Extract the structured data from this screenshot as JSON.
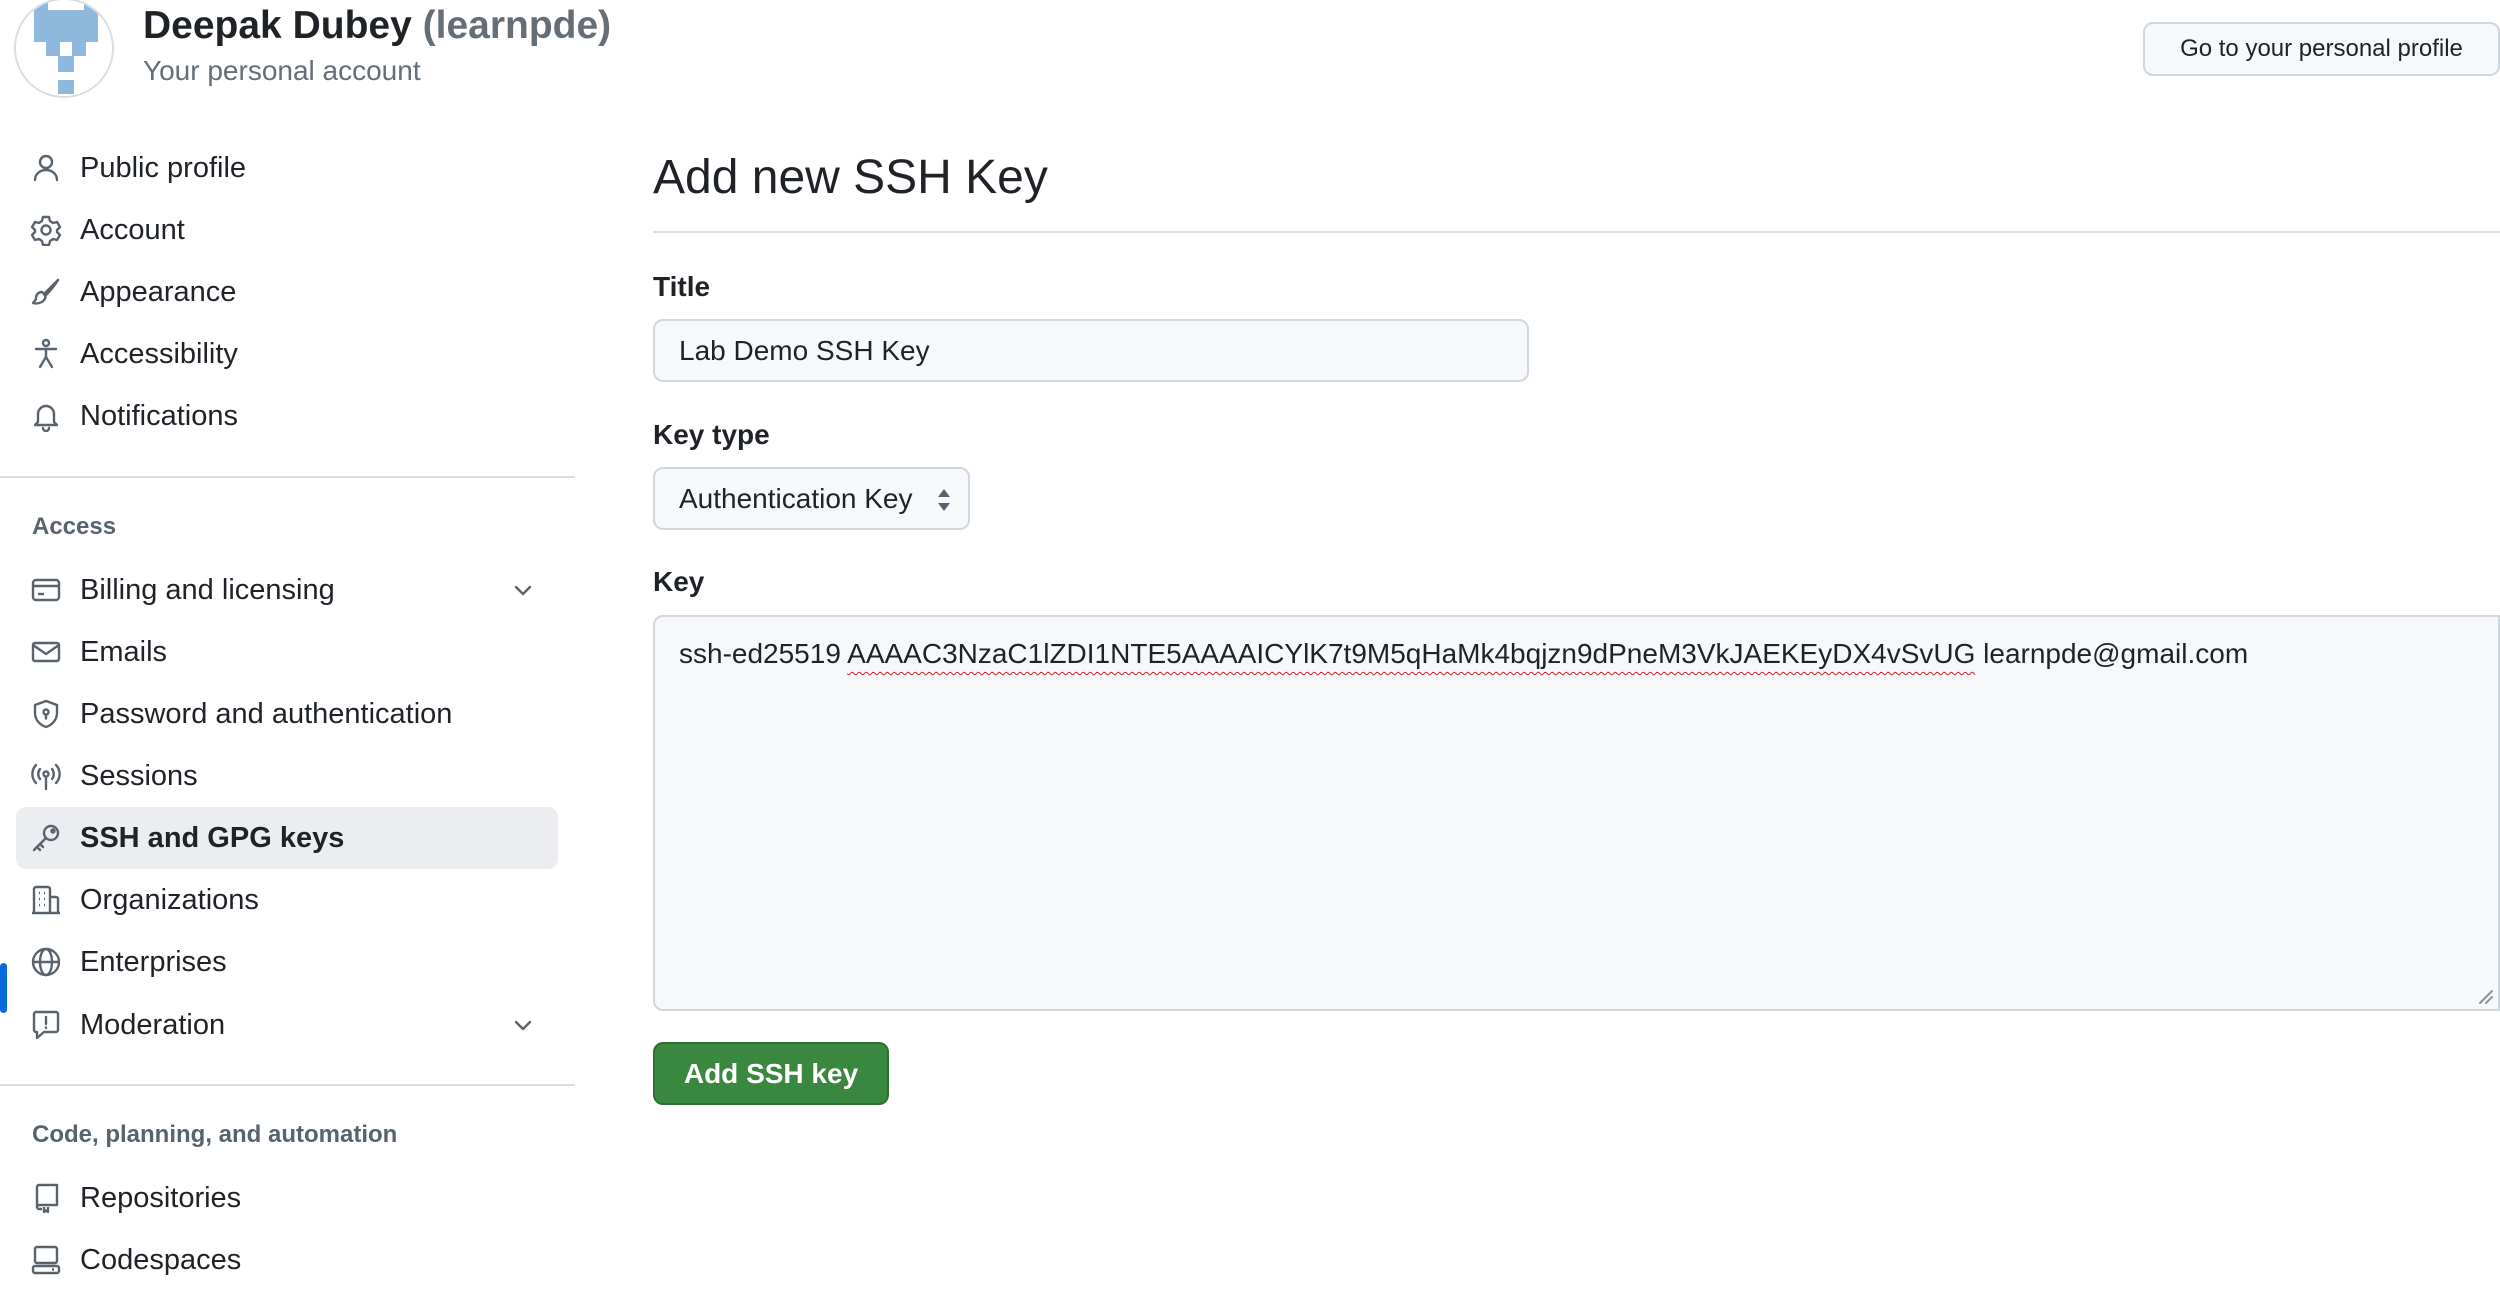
{
  "header": {
    "name": "Deepak Dubey",
    "login": "(learnpde)",
    "subtitle": "Your personal account",
    "profile_button": "Go to your personal profile"
  },
  "sidebar": {
    "items": [
      {
        "label": "Public profile",
        "icon": "person-icon"
      },
      {
        "label": "Account",
        "icon": "gear-icon"
      },
      {
        "label": "Appearance",
        "icon": "paintbrush-icon"
      },
      {
        "label": "Accessibility",
        "icon": "accessibility-icon"
      },
      {
        "label": "Notifications",
        "icon": "bell-icon"
      }
    ],
    "access_title": "Access",
    "access_items": [
      {
        "label": "Billing and licensing",
        "icon": "credit-card-icon",
        "expandable": true
      },
      {
        "label": "Emails",
        "icon": "mail-icon"
      },
      {
        "label": "Password and authentication",
        "icon": "shield-lock-icon"
      },
      {
        "label": "Sessions",
        "icon": "broadcast-icon"
      },
      {
        "label": "SSH and GPG keys",
        "icon": "key-icon",
        "active": true
      },
      {
        "label": "Organizations",
        "icon": "organization-icon"
      },
      {
        "label": "Enterprises",
        "icon": "globe-icon"
      },
      {
        "label": "Moderation",
        "icon": "report-icon",
        "expandable": true
      }
    ],
    "code_title": "Code, planning, and automation",
    "code_items": [
      {
        "label": "Repositories",
        "icon": "repo-icon"
      },
      {
        "label": "Codespaces",
        "icon": "codespaces-icon"
      }
    ]
  },
  "main": {
    "page_title": "Add new SSH Key",
    "title_label": "Title",
    "title_value": "Lab Demo SSH Key",
    "key_type_label": "Key type",
    "key_type_value": "Authentication Key",
    "key_label": "Key",
    "key_prefix": "ssh-ed25519 ",
    "key_body": "AAAAC3NzaC1lZDI1NTE5AAAAICYlK7t9M5qHaMk4bqjzn9dPneM3VkJAEKEyDX4vSvUG",
    "key_suffix": " learnpde@gmail.com",
    "submit_label": "Add SSH key"
  },
  "colors": {
    "accent": "#0969da",
    "primary_button": "#3a8740",
    "active_nav_bg": "#ebedf0"
  }
}
